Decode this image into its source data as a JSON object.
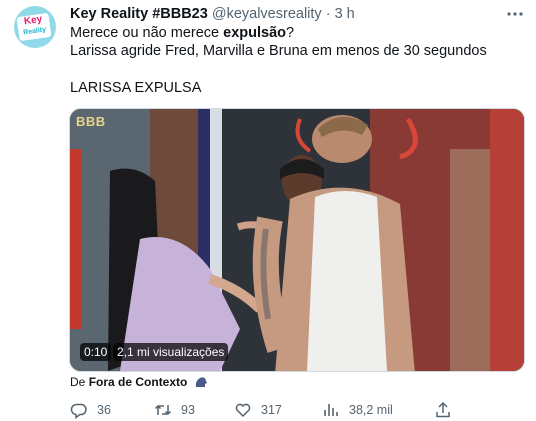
{
  "author": {
    "name": "Key Reality #BBB23",
    "handle": "@keyalvesreality",
    "separator": "·",
    "time": "3 h",
    "avatar_text_line1": "Key",
    "avatar_text_line2": "Reality"
  },
  "tweet": {
    "line1_prefix": "Merece ou não merece ",
    "line1_bold": "expulsão",
    "line1_suffix": "?",
    "line2": "Larissa agride Fred, Marvilla e Bruna em menos de 30 segundos",
    "line3": "LARISSA EXPULSA"
  },
  "media": {
    "watermark": "BBB",
    "duration": "0:10",
    "views": "2,1 mi visualizações"
  },
  "attribution": {
    "prefix": "De ",
    "source": "Fora de Contexto"
  },
  "actions": {
    "replies": "36",
    "retweets": "93",
    "likes": "317",
    "views": "38,2 mil"
  },
  "colors": {
    "text": "#0f1419",
    "secondary": "#536471",
    "avatar_bg": "#8fd9e8"
  },
  "icons": [
    "more-icon",
    "reply-icon",
    "retweet-icon",
    "like-icon",
    "views-icon",
    "share-icon",
    "speaking-head-icon"
  ]
}
